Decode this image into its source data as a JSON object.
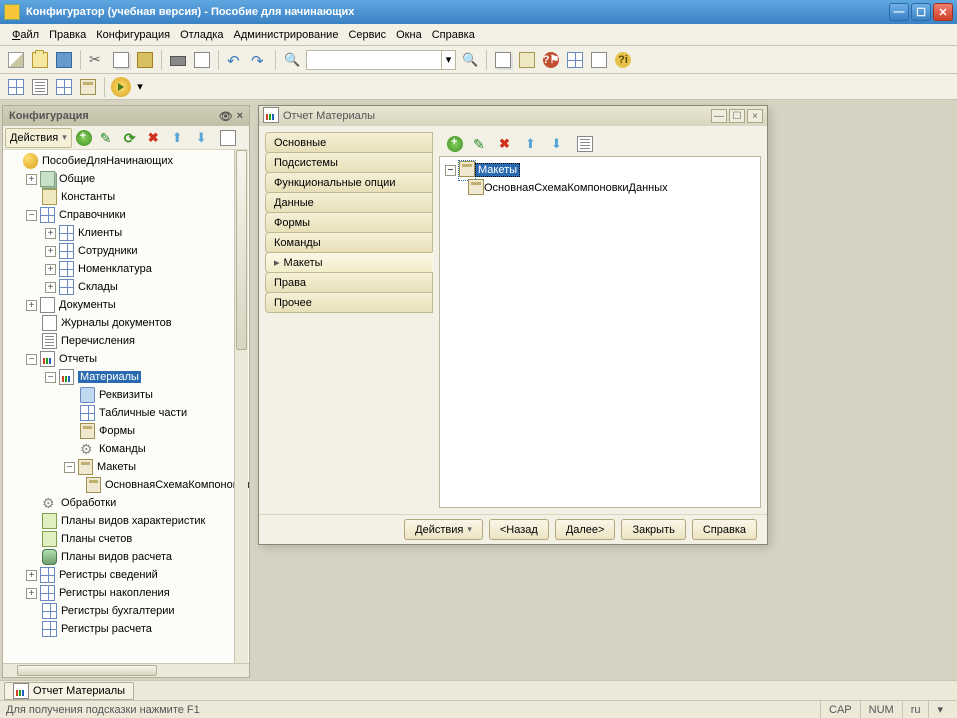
{
  "titlebar": {
    "text": "Конфигуратор (учебная версия) - Пособие для начинающих"
  },
  "menu": {
    "file": "Файл",
    "edit": "Правка",
    "config": "Конфигурация",
    "debug": "Отладка",
    "admin": "Администрирование",
    "service": "Сервис",
    "windows": "Окна",
    "help": "Справка"
  },
  "config_panel": {
    "title": "Конфигурация",
    "actions": "Действия",
    "root": "ПособиеДляНачинающих",
    "nodes": {
      "common": "Общие",
      "constants": "Константы",
      "catalogs": "Справочники",
      "clients": "Клиенты",
      "employees": "Сотрудники",
      "nomenclature": "Номенклатура",
      "warehouses": "Склады",
      "documents": "Документы",
      "doc_journals": "Журналы документов",
      "enums": "Перечисления",
      "reports": "Отчеты",
      "materials": "Материалы",
      "attributes": "Реквизиты",
      "tab_parts": "Табличные части",
      "forms": "Формы",
      "commands": "Команды",
      "layouts": "Макеты",
      "main_schema": "ОсновнаяСхемаКомпоновкиДанных",
      "processing": "Обработки",
      "char_plans": "Планы видов характеристик",
      "account_plans": "Планы счетов",
      "calc_plans": "Планы видов расчета",
      "info_registers": "Регистры сведений",
      "accum_registers": "Регистры накопления",
      "acct_registers": "Регистры бухгалтерии",
      "calc_registers": "Регистры расчета"
    }
  },
  "report_win": {
    "title": "Отчет Материалы",
    "tabs": {
      "main": "Основные",
      "subsystems": "Подсистемы",
      "func_opts": "Функциональные опции",
      "data": "Данные",
      "forms": "Формы",
      "commands": "Команды",
      "layouts": "Макеты",
      "rights": "Права",
      "other": "Прочее"
    },
    "tree": {
      "root": "Макеты",
      "child": "ОсновнаяСхемаКомпоновкиДанных"
    },
    "buttons": {
      "actions": "Действия",
      "back": "<Назад",
      "next": "Далее>",
      "close": "Закрыть",
      "help": "Справка"
    }
  },
  "taskbar": {
    "tab1": "Отчет Материалы"
  },
  "statusbar": {
    "hint": "Для получения подсказки нажмите F1",
    "cap": "CAP",
    "num": "NUM",
    "lang": "ru"
  }
}
